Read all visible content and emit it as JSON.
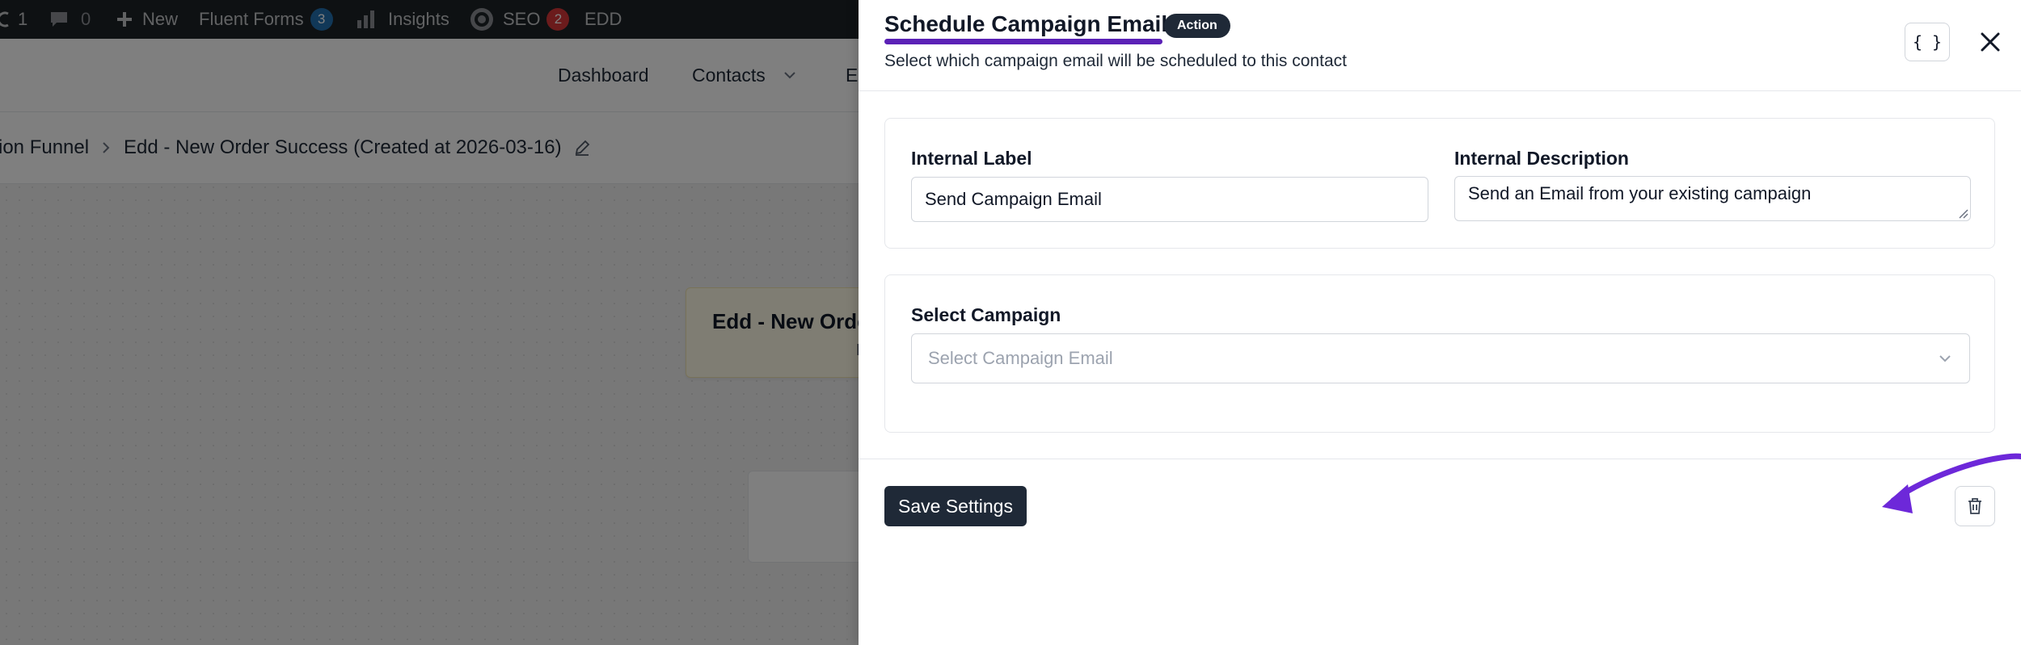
{
  "admin_bar": {
    "updates_count": "1",
    "comments_count": "0",
    "new_label": "New",
    "fluent_forms_label": "Fluent Forms",
    "fluent_forms_count": "3",
    "insights_label": "Insights",
    "seo_label": "SEO",
    "seo_count": "2",
    "edd_label": "EDD"
  },
  "top_nav": {
    "items": [
      "Dashboard",
      "Contacts",
      "E"
    ]
  },
  "breadcrumb": {
    "parent": "ion Funnel",
    "current": "Edd - New Order Success (Created at 2026-03-16)"
  },
  "canvas": {
    "node_title": "Edd - New Orde",
    "node_sub": "E"
  },
  "drawer": {
    "title": "Schedule Campaign Email",
    "badge": "Action",
    "subtitle": "Select which campaign email will be scheduled to this contact",
    "code_button": "{ }",
    "internal_label": {
      "label": "Internal Label",
      "value": "Send Campaign Email"
    },
    "internal_description": {
      "label": "Internal Description",
      "value": "Send an Email from your existing campaign"
    },
    "select_campaign": {
      "label": "Select Campaign",
      "placeholder": "Select Campaign Email"
    },
    "save_button": "Save Settings"
  },
  "colors": {
    "accent_purple": "#5b21b6",
    "dark_button": "#1f2937",
    "fluent_forms_badge": "#2271b1",
    "seo_badge": "#d63638",
    "node_background": "#fffbe6"
  }
}
